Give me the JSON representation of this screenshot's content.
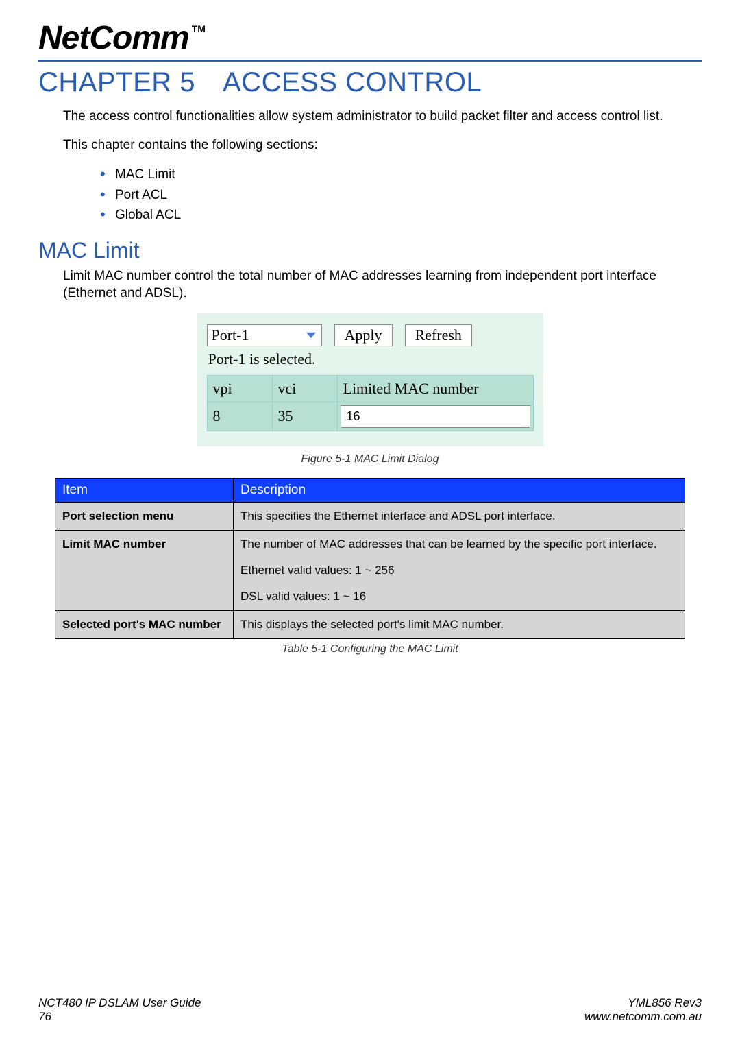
{
  "logo": {
    "text": "NetComm",
    "tm": "TM"
  },
  "chapter": {
    "prefix": "CHAPTER 5",
    "title": "ACCESS CONTROL"
  },
  "intro1": "The access control functionalities allow system administrator to build packet filter and access control list.",
  "intro2": "This chapter contains the following sections:",
  "toc": [
    "MAC Limit",
    "Port ACL",
    "Global ACL"
  ],
  "section": {
    "title": "MAC Limit",
    "body": "Limit MAC number control the total number of MAC addresses learning from independent port interface (Ethernet and ADSL)."
  },
  "dialog": {
    "port_selected": "Port-1",
    "apply": "Apply",
    "refresh": "Refresh",
    "status": "Port-1 is selected.",
    "headers": {
      "vpi": "vpi",
      "vci": "vci",
      "limited": "Limited MAC number"
    },
    "row": {
      "vpi": "8",
      "vci": "35",
      "limited": "16"
    }
  },
  "fig_caption": "Figure 5-1 MAC Limit Dialog",
  "desc_table": {
    "head_item": "Item",
    "head_desc": "Description",
    "rows": [
      {
        "item": "Port selection menu",
        "desc": "This specifies the Ethernet interface and ADSL port interface."
      },
      {
        "item": "Limit MAC number",
        "desc": "The number of MAC addresses that can be learned by the specific port interface.",
        "extra1": "Ethernet valid values: 1 ~ 256",
        "extra2": "DSL valid values: 1 ~ 16"
      },
      {
        "item": "Selected port's MAC number",
        "desc": "This displays the selected port's limit MAC number."
      }
    ]
  },
  "tbl_caption": "Table 5-1 Configuring the MAC Limit",
  "footer": {
    "guide": "NCT480 IP DSLAM User Guide",
    "page": "76",
    "rev": "YML856 Rev3",
    "url": "www.netcomm.com.au"
  }
}
